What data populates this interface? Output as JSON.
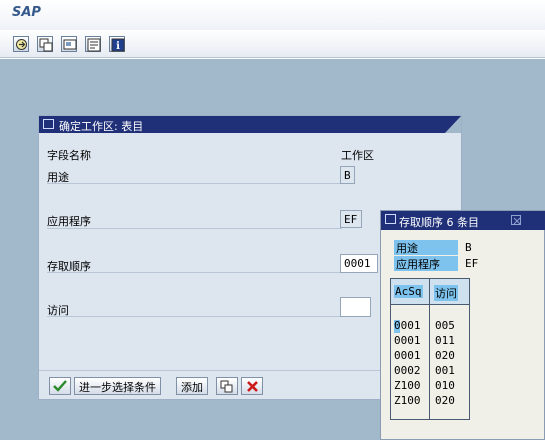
{
  "app": {
    "title": "SAP"
  },
  "toolbar": {
    "buttons": [
      "execute-icon",
      "copy-icon",
      "screen-icon",
      "layout-icon",
      "info-icon"
    ]
  },
  "dialog1": {
    "title": "确定工作区: 表目",
    "header_label": "字段名称",
    "header_value": "工作区",
    "fields": [
      {
        "label": "用途",
        "value": "B"
      },
      {
        "label": "应用程序",
        "value": "EF"
      },
      {
        "label": "存取顺序",
        "value": "0001"
      },
      {
        "label": "访问",
        "value": ""
      }
    ],
    "buttons": {
      "next_selection": "进一步选择条件",
      "add": "添加"
    }
  },
  "dialog2": {
    "title": "存取顺序 6 条目",
    "filters": [
      {
        "label": "用途",
        "value": "B"
      },
      {
        "label": "应用程序",
        "value": "EF"
      }
    ],
    "columns": [
      "AcSq",
      "访问"
    ],
    "rows": [
      [
        "0001",
        "005"
      ],
      [
        "0001",
        "011"
      ],
      [
        "0001",
        "020"
      ],
      [
        "0002",
        "001"
      ],
      [
        "Z100",
        "010"
      ],
      [
        "Z100",
        "020"
      ]
    ]
  },
  "colors": {
    "title_bar": "#1f2f78",
    "workspace": "#a2b8cb",
    "dialog": "#dde5ef",
    "highlight": "#7dc3ee"
  }
}
